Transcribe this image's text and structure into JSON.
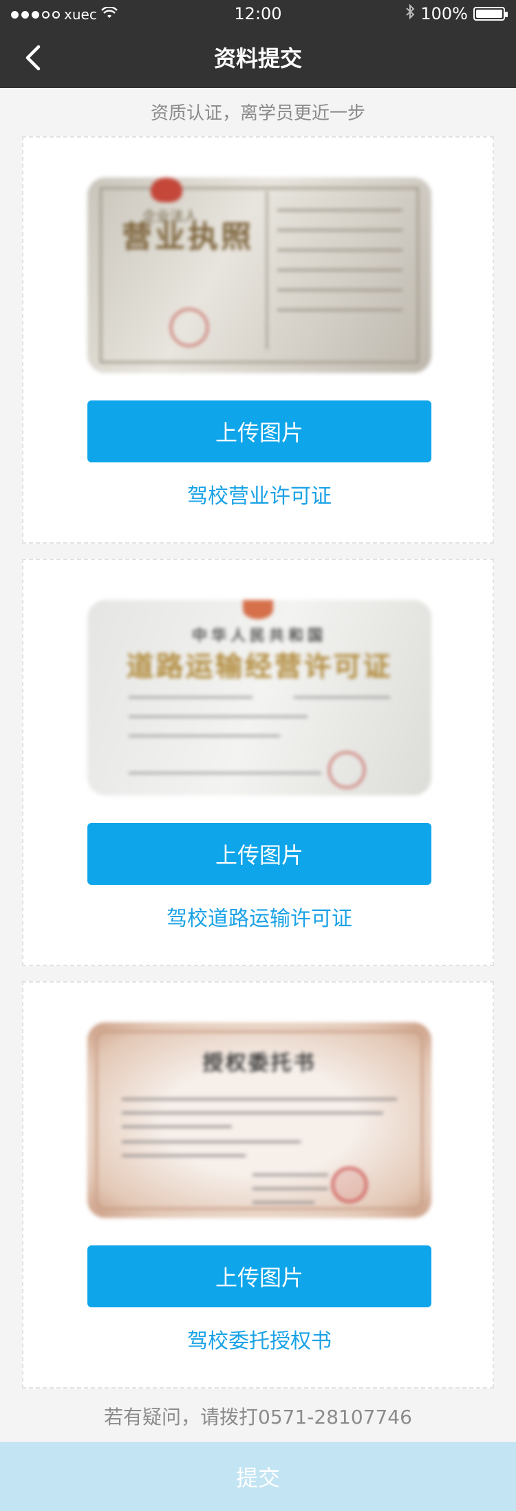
{
  "status_bar": {
    "carrier": "xuec",
    "time": "12:00",
    "battery": "100%"
  },
  "nav": {
    "title": "资料提交"
  },
  "subtitle": "资质认证，离学员更近一步",
  "cards": [
    {
      "upload_label": "上传图片",
      "caption": "驾校营业许可证",
      "doc": {
        "small": "企业法人",
        "big": "营业执照"
      }
    },
    {
      "upload_label": "上传图片",
      "caption": "驾校道路运输许可证",
      "doc": {
        "t1": "中华人民共和国",
        "t2": "道路运输经营许可证"
      }
    },
    {
      "upload_label": "上传图片",
      "caption": "驾校委托授权书",
      "doc": {
        "t": "授权委托书"
      }
    }
  ],
  "help_text": "若有疑问，请拨打0571-28107746",
  "submit_label": "提交"
}
